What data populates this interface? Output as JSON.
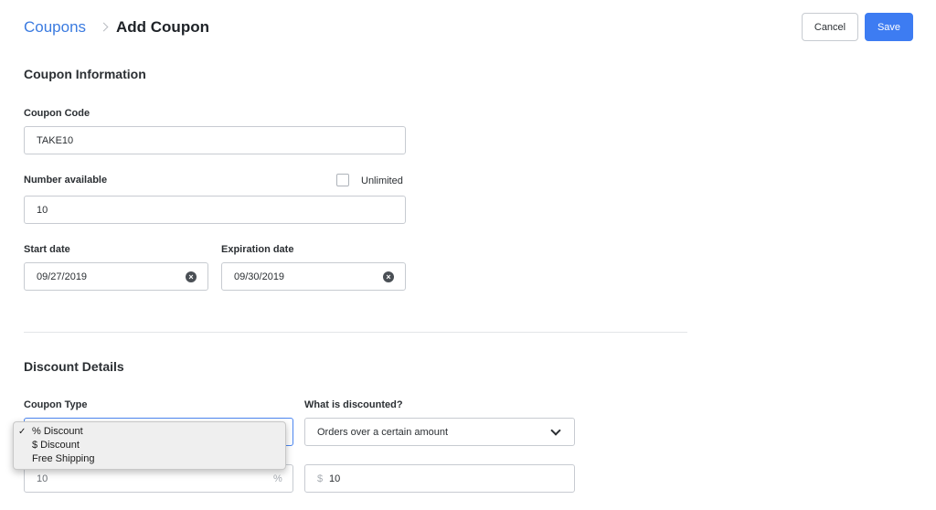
{
  "header": {
    "breadcrumb_parent": "Coupons",
    "breadcrumb_current": "Add Coupon",
    "cancel_label": "Cancel",
    "save_label": "Save"
  },
  "coupon_info": {
    "title": "Coupon Information",
    "code_label": "Coupon Code",
    "code_value": "TAKE10",
    "number_label": "Number available",
    "unlimited_label": "Unlimited",
    "unlimited_checked": false,
    "number_value": "10",
    "start_label": "Start date",
    "start_value": "09/27/2019",
    "expiration_label": "Expiration date",
    "expiration_value": "09/30/2019"
  },
  "discount_details": {
    "title": "Discount Details",
    "type_label": "Coupon Type",
    "type_options": [
      "% Discount",
      "$ Discount",
      "Free Shipping"
    ],
    "type_selected": "% Discount",
    "what_label": "What is discounted?",
    "what_value": "Orders over a certain amount",
    "amount_value": "10",
    "amount_suffix": "%",
    "minimum_prefix": "$",
    "minimum_value": "10"
  },
  "icons": {
    "clear": "clear-circle-icon",
    "chevron": "chevron-down-icon",
    "check": "checkmark-icon"
  },
  "colors": {
    "accent": "#3d7cf2",
    "link": "#3b7be0",
    "border": "#c7cbd1"
  }
}
